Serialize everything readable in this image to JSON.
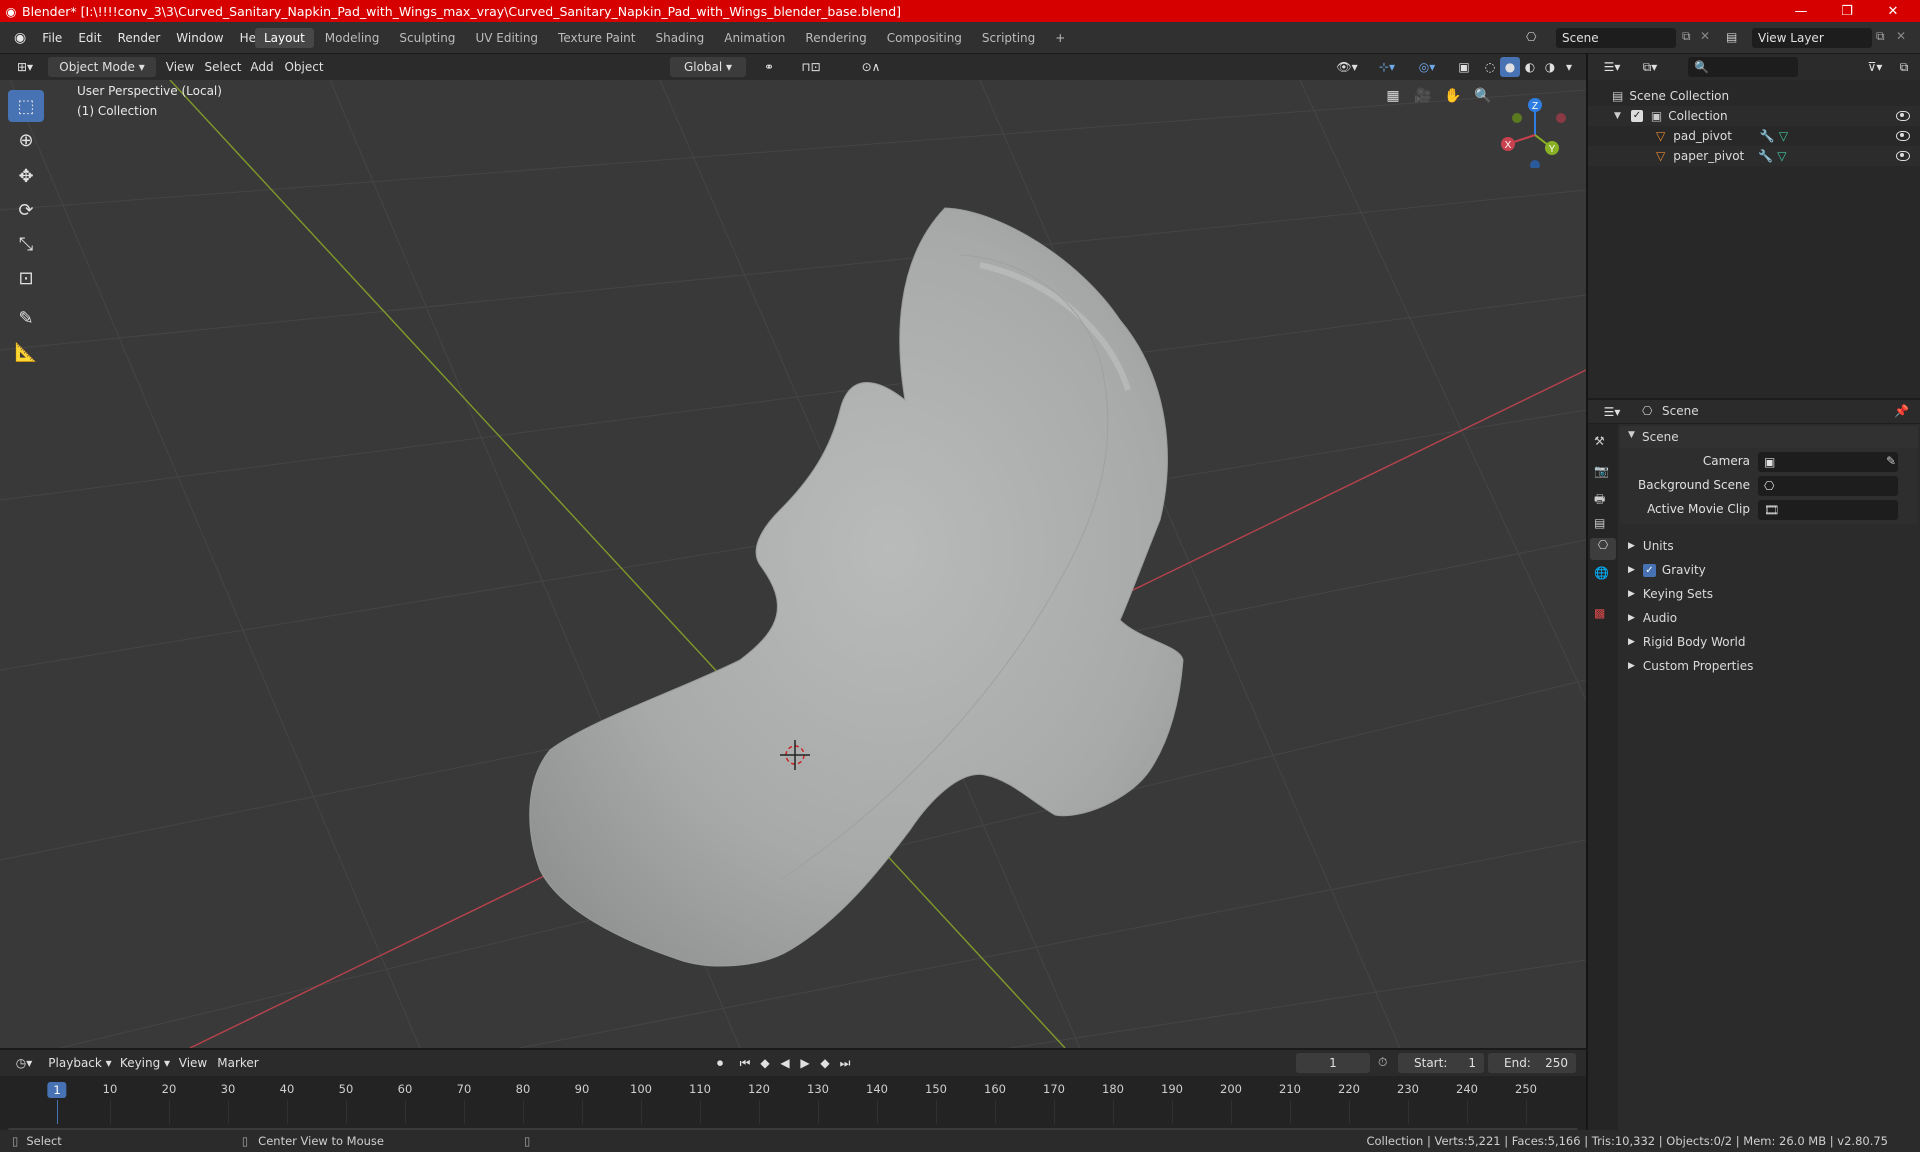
{
  "window": {
    "title": "Blender* [I:\\!!!!conv_3\\3\\Curved_Sanitary_Napkin_Pad_with_Wings_max_vray\\Curved_Sanitary_Napkin_Pad_with_Wings_blender_base.blend]",
    "minimize": "—",
    "maximize": "❐",
    "close": "✕"
  },
  "menu": [
    "File",
    "Edit",
    "Render",
    "Window",
    "Help"
  ],
  "workspaces": [
    "Layout",
    "Modeling",
    "Sculpting",
    "UV Editing",
    "Texture Paint",
    "Shading",
    "Animation",
    "Rendering",
    "Compositing",
    "Scripting"
  ],
  "active_workspace": "Layout",
  "add_workspace": "+",
  "scene_selector": {
    "value": "Scene"
  },
  "viewlayer_selector": {
    "value": "View Layer"
  },
  "viewport_header": {
    "mode": "Object Mode",
    "menus": [
      "View",
      "Select",
      "Add",
      "Object"
    ],
    "orientation": "Global"
  },
  "viewport": {
    "perspective_label": "User Perspective (Local)",
    "collection_label": "(1) Collection",
    "gizmo_axes": {
      "x": "X",
      "y": "Y",
      "z": "Z"
    }
  },
  "outliner": {
    "search_placeholder": "",
    "root": "Scene Collection",
    "collection": "Collection",
    "objects": [
      "pad_pivot",
      "paper_pivot"
    ]
  },
  "properties": {
    "context_title": "Scene",
    "panel_title": "Scene",
    "fields": {
      "camera": "Camera",
      "background_scene": "Background Scene",
      "active_movie_clip": "Active Movie Clip"
    },
    "panels": [
      "Units",
      "Gravity",
      "Keying Sets",
      "Audio",
      "Rigid Body World",
      "Custom Properties"
    ],
    "gravity_checked": true
  },
  "timeline": {
    "menus": [
      "Playback",
      "Keying",
      "View",
      "Marker"
    ],
    "current_frame": "1",
    "start_label": "Start:",
    "start_value": "1",
    "end_label": "End:",
    "end_value": "250",
    "ticks": [
      "1",
      "10",
      "20",
      "30",
      "40",
      "50",
      "60",
      "70",
      "80",
      "90",
      "100",
      "110",
      "120",
      "130",
      "140",
      "150",
      "160",
      "170",
      "180",
      "190",
      "200",
      "210",
      "220",
      "230",
      "240",
      "250"
    ]
  },
  "statusbar": {
    "left_action": "Select",
    "middle_action": "Center View to Mouse",
    "stats": "Collection | Verts:5,221 | Faces:5,166 | Tris:10,332 | Objects:0/2 | Mem: 26.0 MB | v2.80.75"
  },
  "colors": {
    "titlebar": "#d60000",
    "accent": "#4772b3",
    "x_axis": "#c8414f",
    "y_axis": "#8ab024",
    "z_axis": "#2f7de1",
    "object_icon": "#e88a30"
  }
}
